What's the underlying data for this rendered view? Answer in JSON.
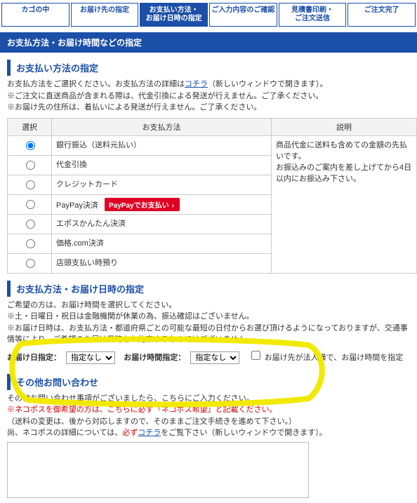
{
  "steps": {
    "s0": "カゴの中",
    "s1": "お届け先の指定",
    "s2": "お支払い方法・\nお届け日時の指定",
    "s3": "ご入力内容のご確認",
    "s4": "見積書印刷・\nご注文送信",
    "s5": "ご注文完了"
  },
  "mainbanner": "お支払方法・お届け時間などの指定",
  "payment": {
    "heading": "お支払い方法の指定",
    "intro1_pre": "お支払方法をご選択ください。お支払方法の詳細は",
    "intro1_link": "コチラ",
    "intro1_post": "（新しいウィンドウで開きます）。",
    "intro2": "※ご注文に直送商品が含まれる際は、代金引換による発送が行えません。ご了承ください。",
    "intro3": "※お届け先の住所は、着払いによる発送が行えません。ご了承ください。",
    "th_select": "選択",
    "th_method": "お支払方法",
    "th_desc": "説明",
    "methods": {
      "m0": "銀行振込（送料元払い）",
      "m1": "代金引換",
      "m2": "クレジットカード",
      "m3": "PayPay決済",
      "m4": "エポスかんたん決済",
      "m5": "価格.com決済",
      "m6": "店頭支払い時預り"
    },
    "paypay_btn": "PayPayでお支払い",
    "desc1": "商品代金に送料も含めての金額の先払いです。",
    "desc2": "お振込みのご案内を差し上げてから4日以内にお振込み下さい。"
  },
  "delivery": {
    "heading": "お支払方法・お届け日時の指定",
    "l1": "ご希望の方は、お届け時間を選択してください。",
    "l2": "※土・日曜日・祝日は金融機関が休業の為、振込確認はございません。",
    "l3": "※お届け日時は、お支払方法・都道府県ごとの可能な最短の日付からお選び頂けるようになっておりますが、交通事情等により、ご希望のお届け日時をお約束するものではございません。",
    "label_date": "お届け日指定：",
    "label_time": "お届け時間指定：",
    "opt_none": "指定なし",
    "cb_label": "お届け先が法人様で、お届け時間を指定"
  },
  "inquiry": {
    "heading": "その他お問い合わせ",
    "l1": "その他お問い合わせ事項がございましたら、こちらにご入力ください。",
    "l2": "※ネコポスを御希望の方は、こちらに必ず「ネコポス希望」と記載ください。",
    "l3": "（送料の変更は、後から対応しますので、そのままご注文手続きを進めて下さい。）",
    "l4_pre": "尚、ネコポスの詳細については、",
    "l4_must": "必ず",
    "l4_link": "コチラ",
    "l4_post": "をご覧下さい（新しいウィンドウで開きます）。"
  }
}
